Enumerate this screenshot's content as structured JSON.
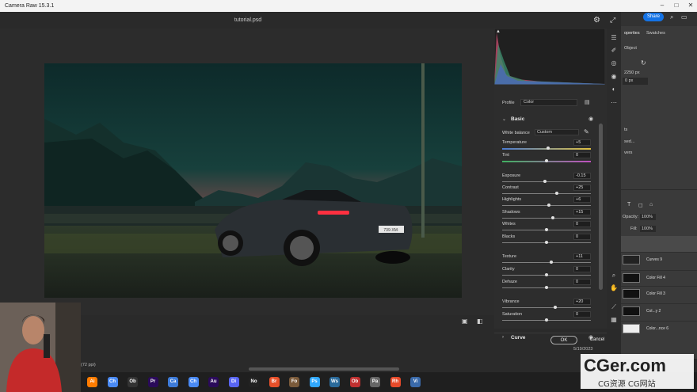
{
  "window": {
    "title": "Camera Raw 15.3.1"
  },
  "document": {
    "filename": "tutorial.psd"
  },
  "profile": {
    "label": "Profile",
    "value": "Color"
  },
  "basic": {
    "section": "Basic",
    "wb_label": "White balance",
    "wb_value": "Custom",
    "sliders": [
      {
        "label": "Temperature",
        "value": "+5",
        "pos": 0.52
      },
      {
        "label": "Tint",
        "value": "0",
        "pos": 0.5
      },
      {
        "label": "Exposure",
        "value": "-0.15",
        "pos": 0.48
      },
      {
        "label": "Contrast",
        "value": "+25",
        "pos": 0.62
      },
      {
        "label": "Highlights",
        "value": "+6",
        "pos": 0.53
      },
      {
        "label": "Shadows",
        "value": "+15",
        "pos": 0.57
      },
      {
        "label": "Whites",
        "value": "0",
        "pos": 0.5
      },
      {
        "label": "Blacks",
        "value": "0",
        "pos": 0.5
      },
      {
        "label": "Texture",
        "value": "+11",
        "pos": 0.55
      },
      {
        "label": "Clarity",
        "value": "0",
        "pos": 0.5
      },
      {
        "label": "Dehaze",
        "value": "0",
        "pos": 0.5
      },
      {
        "label": "Vibrance",
        "value": "+20",
        "pos": 0.6
      },
      {
        "label": "Saturation",
        "value": "0",
        "pos": 0.5
      }
    ]
  },
  "curve": {
    "section": "Curve"
  },
  "actions": {
    "ok": "OK",
    "cancel": "Cancel"
  },
  "ps": {
    "share": "Share",
    "tabs": {
      "properties": "operties",
      "swatches": "Swatches"
    },
    "object": "Object",
    "width": "2250 px",
    "height_field": "0 px",
    "opacity_label": "Opacity:",
    "opacity_value": "100%",
    "fill_label": "Fill:",
    "fill_value": "100%",
    "side_labels": [
      "ts",
      "sed...",
      "vers"
    ],
    "layers": [
      "Curves 9",
      "Color Fill 4",
      "Color Fill 3",
      "Col...y 2",
      "Color...nce 6"
    ],
    "zoom_text": "(72 ppi)",
    "date": "5/19/2023"
  },
  "plate_text": "739·XM·",
  "watermark": {
    "main": "CGer.com",
    "sub": "CG资源 CG网站"
  },
  "taskbar": [
    "Ai",
    "Ch",
    "Ob",
    "Pr",
    "Ca",
    "Ch",
    "Au",
    "Di",
    "No",
    "Br",
    "Fo",
    "Ps",
    "Ws",
    "Ob",
    "Pa",
    "Rh",
    "Vi"
  ]
}
